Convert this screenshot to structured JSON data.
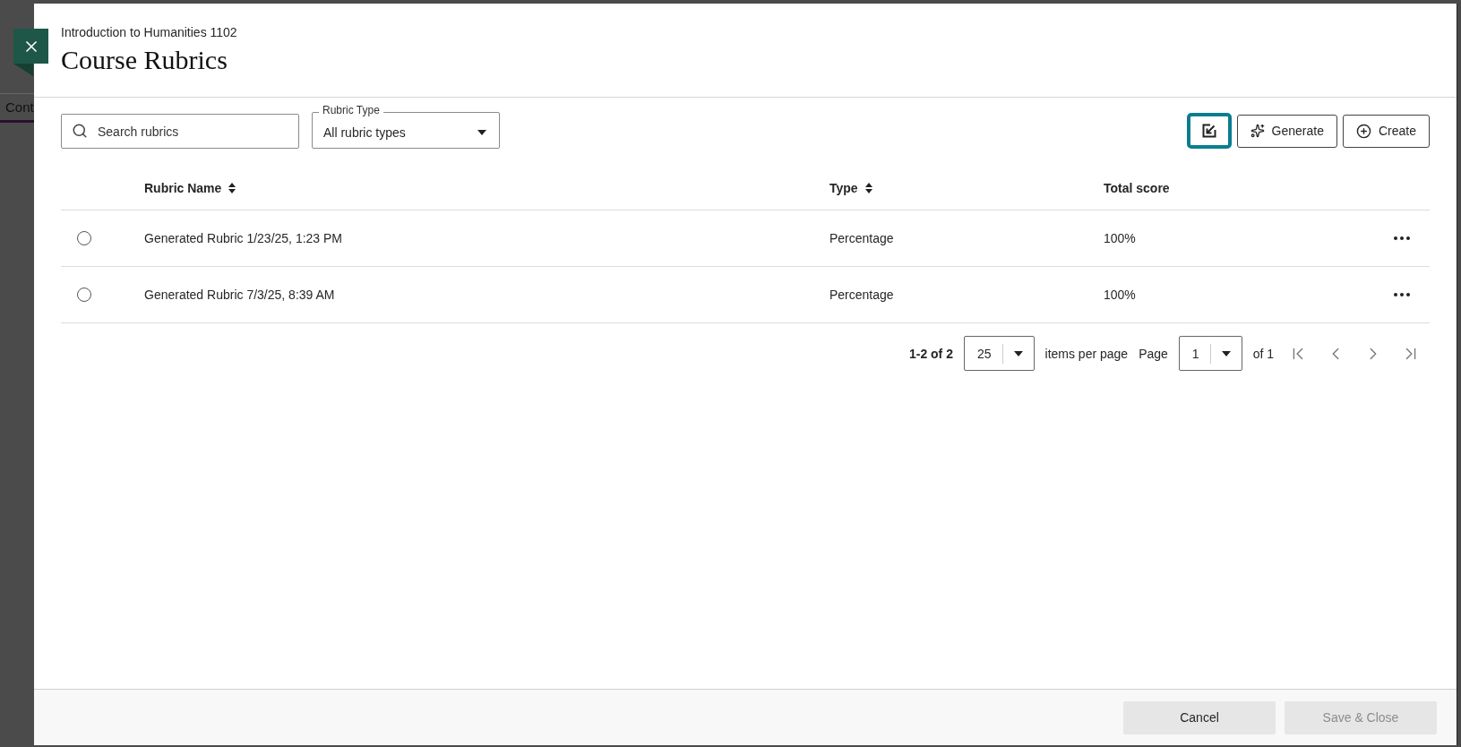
{
  "background_page": {
    "tab_label": "Cont"
  },
  "dialog": {
    "course": "Introduction to Humanities 1102",
    "title": "Course Rubrics"
  },
  "toolbar": {
    "search": {
      "placeholder": "Search rubrics"
    },
    "filter": {
      "label": "Rubric Type",
      "value": "All rubric types"
    },
    "buttons": [
      {
        "kind": "icon",
        "focused": true
      },
      {
        "kind": "generate",
        "label": "Generate",
        "focused": false
      },
      {
        "kind": "create",
        "label": "Create",
        "focused": false
      }
    ]
  },
  "table": {
    "columns": [
      {
        "label": "Rubric Name",
        "sortable": true
      },
      {
        "label": "Type",
        "sortable": true
      },
      {
        "label": "Total score",
        "sortable": false
      }
    ],
    "rows": [
      {
        "name": "Generated Rubric 1/23/25, 1:23 PM",
        "type": "Percentage",
        "total_score": "100%",
        "selected": false
      },
      {
        "name": "Generated Rubric 7/3/25, 8:39 AM",
        "type": "Percentage",
        "total_score": "100%",
        "selected": false
      }
    ]
  },
  "pagination": {
    "range": "1-2 of 2",
    "per_page": "25",
    "per_page_label": "items per page",
    "page_label": "Page",
    "page": "1",
    "page_count": "of 1"
  },
  "footer": {
    "buttons": [
      {
        "label": "Cancel",
        "disabled": false
      },
      {
        "label": "Save & Close",
        "disabled": true
      }
    ]
  }
}
